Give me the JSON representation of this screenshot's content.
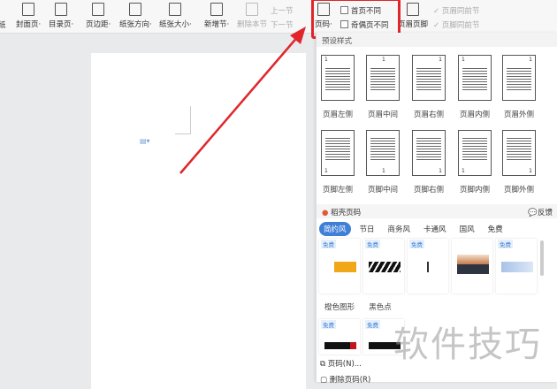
{
  "toolbar": {
    "partial": "纸",
    "cover": "封面页·",
    "toc": "目录页·",
    "margin": "页边距·",
    "orientation": "纸张方向·",
    "size": "纸张大小·",
    "new_section": "新增节·",
    "delete_section": "删除本节",
    "prev_section": "上一节",
    "next_section": "下一节",
    "page_number": "页码·",
    "first_diff": "首页不同",
    "odd_even_diff": "奇偶页不同",
    "header_footer": "页眉页脚",
    "header_same": "页眉同前节",
    "footer_same": "页脚同前节"
  },
  "panel": {
    "preset_title": "预设样式",
    "headers": [
      "页眉左侧",
      "页眉中间",
      "页眉右侧",
      "页眉内侧",
      "页眉外侧"
    ],
    "footers": [
      "页脚左侧",
      "页脚中间",
      "页脚右侧",
      "页脚内侧",
      "页脚外侧"
    ],
    "section_title": "稻壳页码",
    "feedback": "反馈",
    "tabs": [
      "简约风",
      "节日",
      "商务风",
      "卡通风",
      "国风",
      "免费"
    ],
    "free_badge": "免费",
    "card_labels": [
      "橙色图形",
      "黑色点"
    ],
    "menu": [
      "页码(N)...",
      "删除页码(R)"
    ]
  },
  "watermark": "软件技巧",
  "colors": {
    "accent": "#3f7fd8",
    "highlight": "#e0262b"
  }
}
